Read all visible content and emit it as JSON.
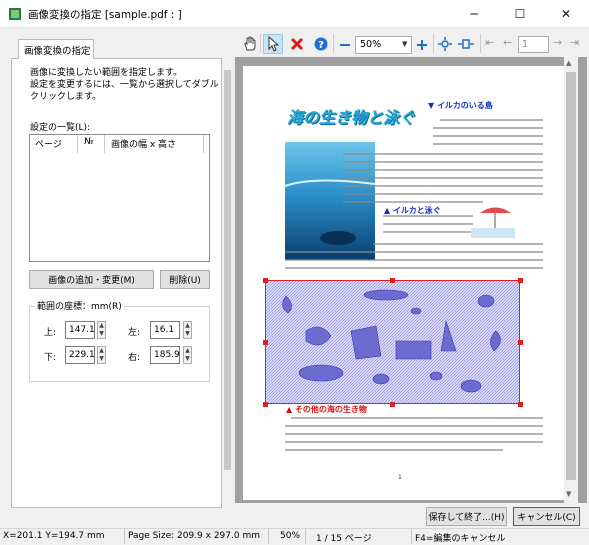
{
  "window": {
    "title": "画像変換の指定 [sample.pdf : ]",
    "controls": [
      "─",
      "☐",
      "✕"
    ]
  },
  "left_panel": {
    "tab_label": "画像変換の指定",
    "description_lines": [
      "画像に変換したい範囲を指定します。",
      "設定を変更するには、一覧から選択してダブル",
      "クリックします。"
    ],
    "list_label": "設定の一覧(L):",
    "list_columns": [
      "ページ",
      "№",
      "画像の幅 x 高さ"
    ],
    "add_button": "画像の追加・変更(M)",
    "delete_button": "削除(U)",
    "coords_group_label": "範囲の座標：mm(R)",
    "coords": {
      "top_label": "上:",
      "top_value": "147.1",
      "left_label": "左:",
      "left_value": "16.1",
      "bottom_label": "下:",
      "bottom_value": "229.1",
      "right_label": "右:",
      "right_value": "185.9"
    }
  },
  "toolbar": {
    "zoom_value": "50%",
    "page_value": "1",
    "icons": [
      "hand-icon",
      "pointer-icon",
      "delete-icon",
      "help-icon",
      "zoom-out-icon",
      "zoom-in-icon",
      "fit-icon",
      "fit-width-icon",
      "first-page-icon",
      "prev-page-icon",
      "next-page-icon",
      "last-page-icon"
    ]
  },
  "document": {
    "headline": "海の生き物と泳ぐ",
    "section1": "▼ イルカのいる島",
    "section2": "▲ イルカと泳ぐ",
    "section3": "▲ その他の海の生き物",
    "page_number": "1"
  },
  "footer_buttons": {
    "save_exit": "保存して終了...(H)",
    "cancel": "キャンセル(C)"
  },
  "status_bar": {
    "cursor": "X=201.1 Y=194.7 mm",
    "page_size": "Page Size: 209.9 x 297.0 mm",
    "zoom": "50%",
    "page": "1 / 15 ページ",
    "hint": "F4=編集のキャンセル"
  },
  "colors": {
    "selection_border": "#e02020",
    "selection_fill": "#7070e0",
    "headline": "#29a8d8",
    "section_red": "#d81010",
    "section_blue": "#1030c0"
  }
}
